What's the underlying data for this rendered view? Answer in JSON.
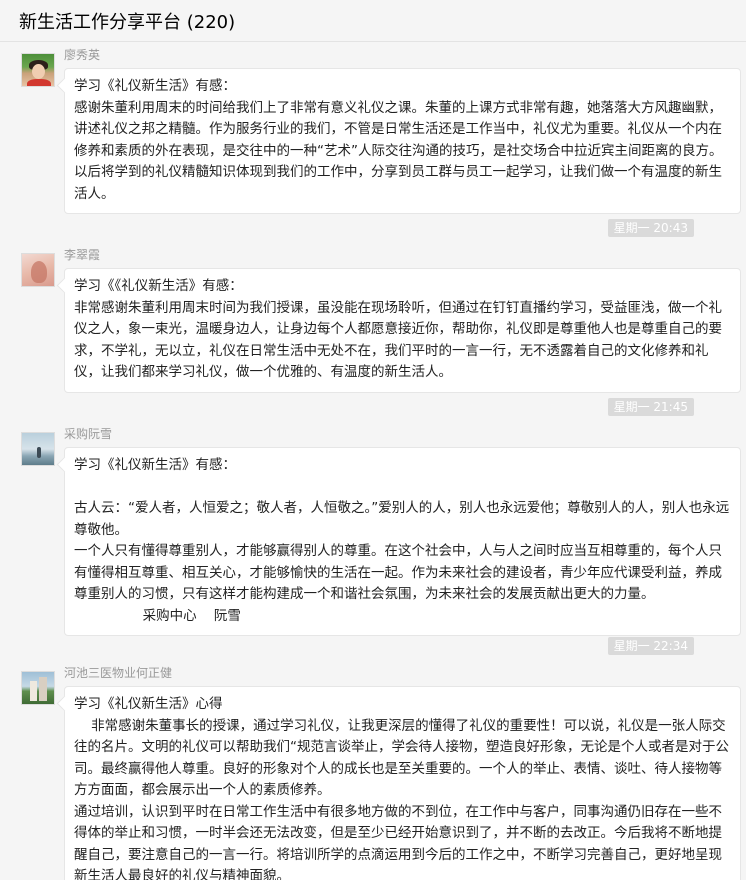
{
  "header": {
    "title": "新生活工作分享平台 (220)"
  },
  "messages": [
    {
      "sender": "廖秀英",
      "paragraphs": [
        "学习《礼仪新生活》有感：",
        "感谢朱董利用周末的时间给我们上了非常有意义礼仪之课。朱董的上课方式非常有趣，她落落大方风趣幽默，讲述礼仪之邦之精髓。作为服务行业的我们，不管是日常生活还是工作当中，礼仪尤为重要。礼仪从一个内在修养和素质的外在表现，是交往中的一种“艺术”人际交往沟通的技巧，是社交场合中拉近宾主间距离的良方。以后将学到的礼仪精髓知识体现到我们的工作中，分享到员工群与员工一起学习，让我们做一个有温度的新生活人。"
      ]
    },
    {
      "time": "星期一 20:43"
    },
    {
      "sender": "李翠霞",
      "paragraphs": [
        "学习《《礼仪新生活》有感：",
        "非常感谢朱董利用周末时间为我们授课，虽没能在现场聆听，但通过在钉钉直播约学习，受益匪浅，做一个礼仪之人，象一束光，温暖身边人，让身边每个人都愿意接近你，帮助你，礼仪即是尊重他人也是尊重自己的要求，不学礼，无以立，礼仪在日常生活中无处不在，我们平时的一言一行，无不透露着自己的文化修养和礼仪，让我们都来学习礼仪，做一个优雅的、有温度的新生活人。"
      ]
    },
    {
      "time": "星期一 21:45"
    },
    {
      "sender": "采购阮雪",
      "paragraphs": [
        "学习《礼仪新生活》有感：",
        "",
        "古人云：“爱人者，人恒爱之；敬人者，人恒敬之。”爱别人的人，别人也永远爱他；尊敬别人的人，别人也永远尊敬他。",
        "一个人只有懂得尊重别人，才能够赢得别人的尊重。在这个社会中，人与人之间时应当互相尊重的，每个人只有懂得相互尊重、相互关心，才能够愉快的生活在一起。作为未来社会的建设者，青少年应代课受利益，养成尊重别人的习惯，只有这样才能构建成一个和谐社会氛围，为未来社会的发展贡献出更大的力量。",
        "                采购中心    阮雪"
      ]
    },
    {
      "time": "星期一 22:34"
    },
    {
      "sender": "河池三医物业何正健",
      "paragraphs": [
        "学习《礼仪新生活》心得",
        "    非常感谢朱董事长的授课，通过学习礼仪，让我更深层的懂得了礼仪的重要性！可以说，礼仪是一张人际交往的名片。文明的礼仪可以帮助我们“规范言谈举止，学会待人接物，塑造良好形象，无论是个人或者是对于公司。最终赢得他人尊重。良好的形象对个人的成长也是至关重要的。一个人的举止、表情、谈吐、待人接物等方方面面，都会展示出一个人的素质修养。",
        "通过培训，认识到平时在日常工作生活中有很多地方做的不到位，在工作中与客户，同事沟通仍旧存在一些不得体的举止和习惯，一时半会还无法改变，但是至少已经开始意识到了，并不断的去改正。今后我将不断地提醒自己，要注意自己的一言一行。将培训所学的点滴运用到今后的工作之中，不断学习完善自己，更好地呈现新生活人最良好的礼仪与精神面貌。"
      ]
    }
  ]
}
